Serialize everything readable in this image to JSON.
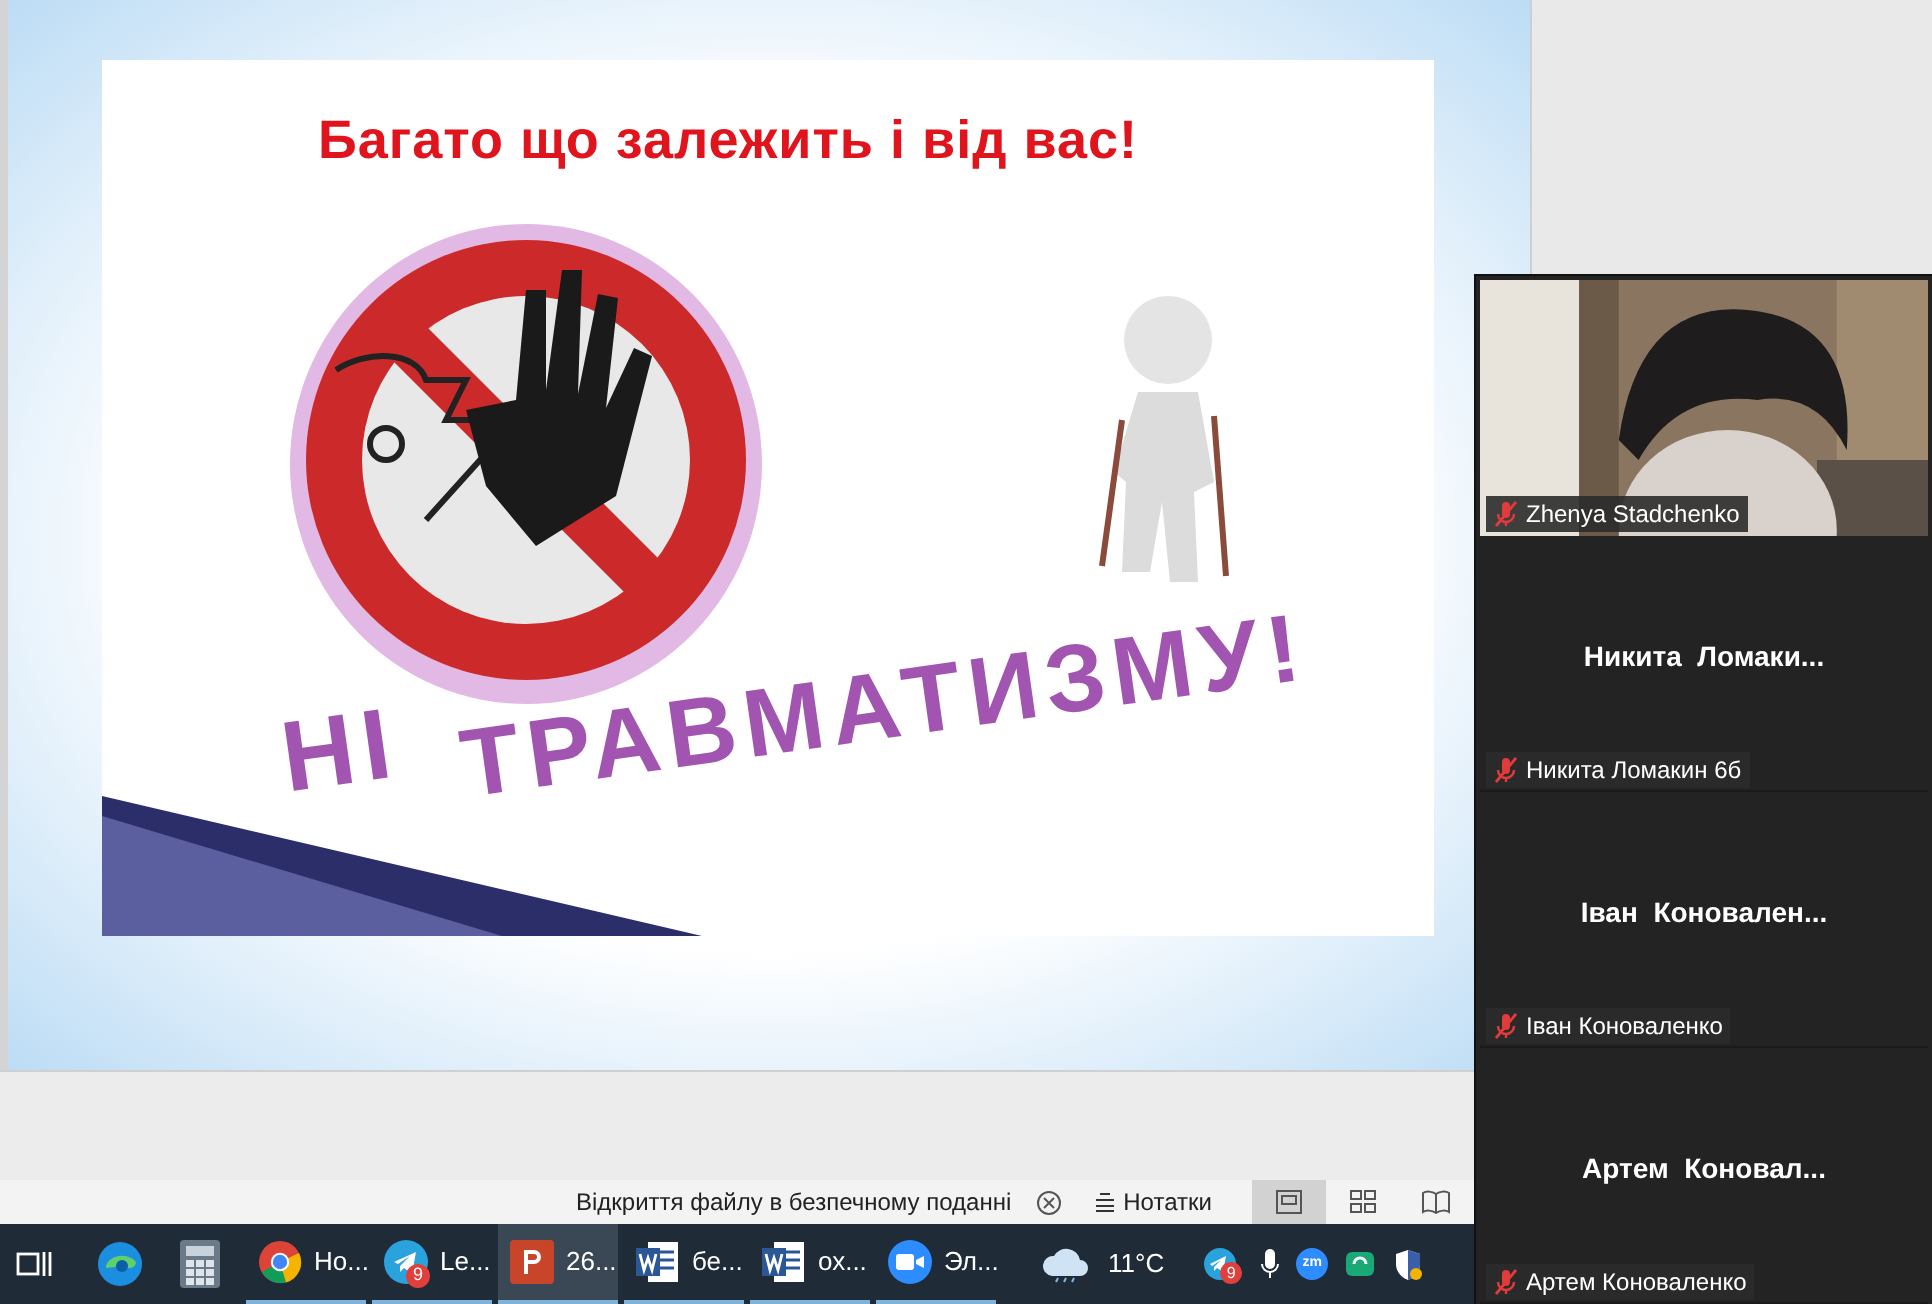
{
  "slide": {
    "headline": "Багато що залежить і від вас!",
    "slogan_1": "НІ",
    "slogan_2": "ТРАВМАТИЗМУ!"
  },
  "status_bar": {
    "message": "Відкриття файлу в безпечному поданні",
    "notes": "Нотатки",
    "views": [
      {
        "selected": true
      },
      {
        "selected": false
      },
      {
        "selected": false
      }
    ]
  },
  "taskbar": {
    "apps": [
      {
        "kind": "edge"
      },
      {
        "kind": "calculator"
      },
      {
        "kind": "chrome",
        "label": "Но..."
      },
      {
        "kind": "telegram",
        "label": "Le...",
        "badge": "9"
      },
      {
        "kind": "powerpoint",
        "label": "26...",
        "selected": true
      },
      {
        "kind": "word",
        "label": "бе...",
        "selected": false
      },
      {
        "kind": "word",
        "label": "ох...",
        "selected": false
      },
      {
        "kind": "zoom",
        "label": "Эл...",
        "selected": false
      }
    ],
    "weather": "11°C",
    "tray_badge": "9",
    "zoom_tray": "zm"
  },
  "participants": [
    {
      "kind": "video",
      "label": "Zhenya Stadchenko"
    },
    {
      "kind": "name",
      "display": "Никита  Ломаки...",
      "label": "Никита Ломакин 6б"
    },
    {
      "kind": "name",
      "display": "Іван  Коновален...",
      "label": "Іван Коноваленко"
    },
    {
      "kind": "name",
      "display": "Артем  Коновал...",
      "label": "Артем Коноваленко"
    }
  ]
}
